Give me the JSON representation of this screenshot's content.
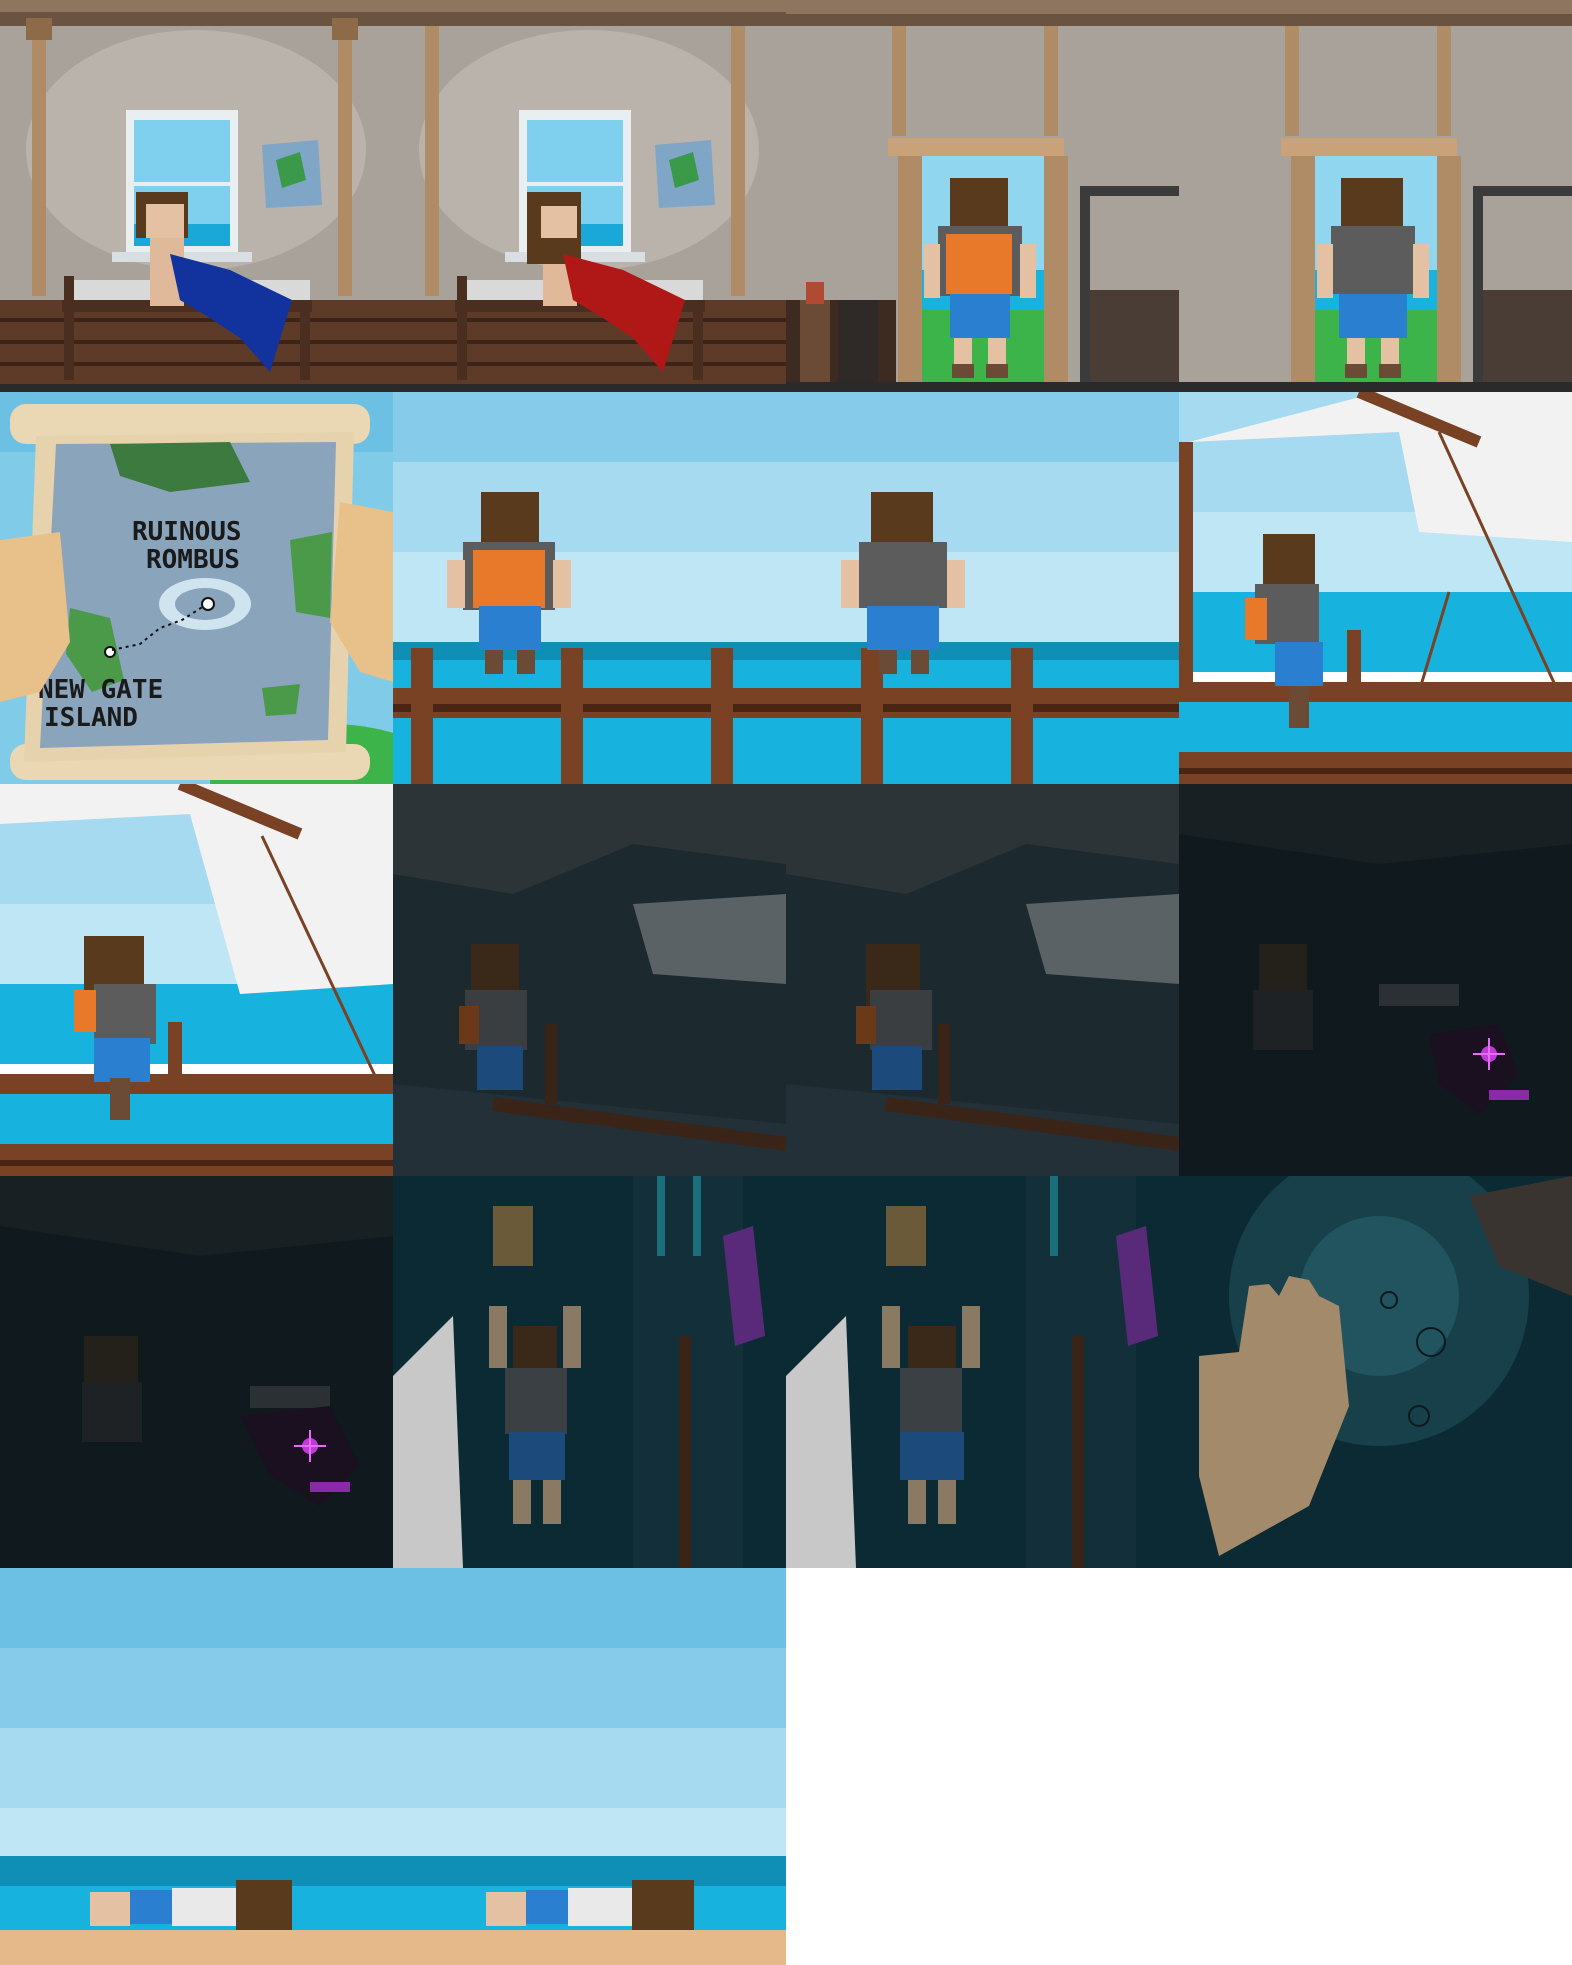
{
  "sheet": {
    "type": "sprite-sheet / storyboard",
    "background": "#ffffff"
  },
  "map_scroll": {
    "destination_label_line1": "RUINOUS",
    "destination_label_line2": "ROMBUS",
    "origin_label_line1": "NEW GATE",
    "origin_label_line2": "ISLAND"
  },
  "colors": {
    "sky_light": "#bfe6f5",
    "sky": "#86cbe9",
    "sea": "#18b2de",
    "sea_dark": "#0f8fb5",
    "wood": "#7a4224",
    "wood_dark": "#4a2514",
    "cabin_wall": "#a8a29a",
    "storm": "#1c2a30",
    "underwater": "#0c2a33",
    "hair": "#5a3a1c",
    "backpack": "#e8782a",
    "shorts": "#2b7fd0",
    "blanket_boy": "#12329e",
    "blanket_girl": "#b01818",
    "void_eye": "#c03ad8",
    "sand": "#e6b98a"
  }
}
